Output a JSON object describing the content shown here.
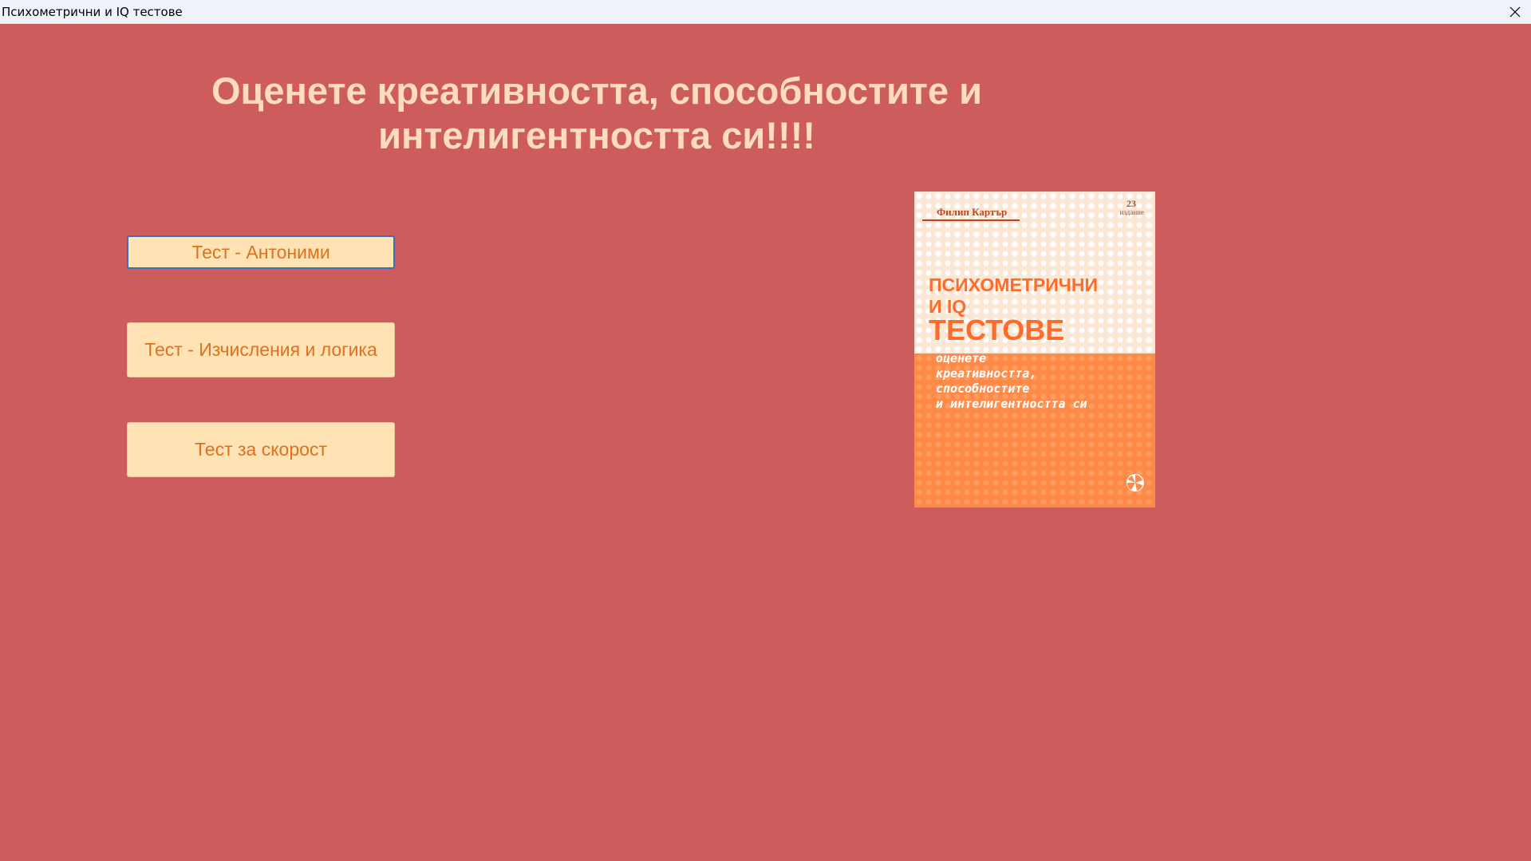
{
  "window": {
    "title": "Психометрични и IQ тестове",
    "close_icon": "close-icon"
  },
  "colors": {
    "background": "#cd5c5c",
    "headline": "#ffdcc0",
    "button_bg": "#ffe3b5",
    "button_text": "#e0701e",
    "focus_border": "#3d6fb5"
  },
  "main": {
    "headline_line1": "Оценете креативността, способностите и",
    "headline_line2": "интелигентността си!!!!"
  },
  "buttons": {
    "antonyms": "Тест - Антоними",
    "calc_logic": "Тест - Изчисления и логика",
    "speed": "Тест за скорост"
  },
  "book_cover": {
    "author": "Филип Картър",
    "edition_number": "23",
    "edition_label": "издание",
    "title_line1": "ПСИХОМЕТРИЧНИ",
    "title_line2": "И IQ",
    "title_line3": "ТЕСТОВЕ",
    "subtitle_line1": "оценете",
    "subtitle_line2": "креативността,",
    "subtitle_line3": "способностите",
    "subtitle_line4": "и интелигентността си",
    "logo_icon": "publisher-logo-icon"
  }
}
